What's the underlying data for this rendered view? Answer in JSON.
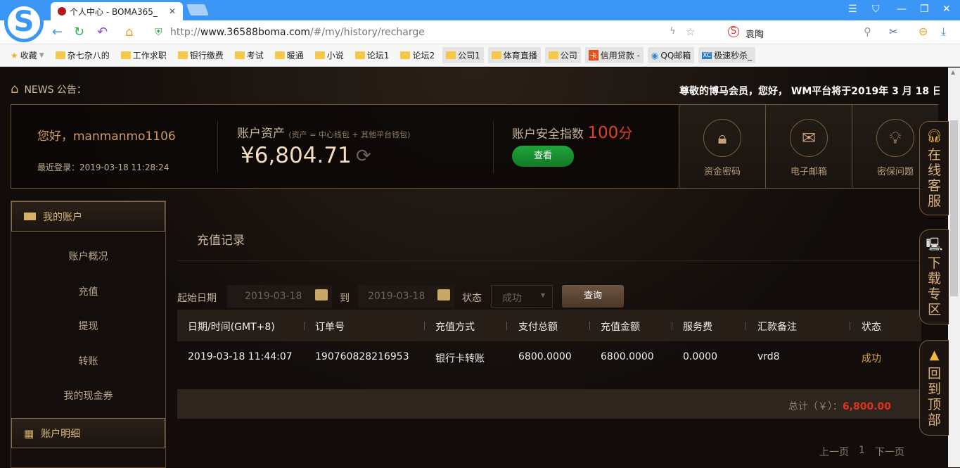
{
  "browser": {
    "tab_title": "个人中心 - BOMA365_",
    "url_prefix": "http://",
    "url_domain": "www.36588boma.com",
    "url_path": "/#/my/history/recharge",
    "search_text": "袁陶",
    "bookmarks": [
      "收藏",
      "杂七杂八的",
      "工作求职",
      "银行缴费",
      "考试",
      "暖通",
      "小说",
      "论坛1",
      "论坛2",
      "公司1",
      "体育直播",
      "公司",
      "信用贷款 -",
      "QQ邮箱",
      "极速秒杀_"
    ]
  },
  "news": {
    "label": "NEWS 公告：",
    "ticker": "尊敬的博马会员，您好， WM平台将于2019年 3 月 18 日"
  },
  "account": {
    "greeting": "您好，manmanmo1106",
    "last_login": "最近登录：2019-03-18 11:28:24",
    "assets_label": "账户资产",
    "assets_note": "(资产 = 中心钱包 + 其他平台钱包)",
    "balance": "¥6,804.71",
    "security_label": "账户安全指数",
    "security_score": "100",
    "security_unit": "分",
    "view_button": "查看",
    "shortcuts": [
      "资金密码",
      "电子邮箱",
      "密保问题"
    ]
  },
  "sidebar": {
    "section1": "我的账户",
    "items": [
      "账户概况",
      "充值",
      "提现",
      "转账",
      "我的现金券"
    ],
    "section2": "账户明细"
  },
  "main": {
    "title": "充值记录",
    "start_label": "起始日期",
    "start_date": "2019-03-18",
    "to_label": "到",
    "end_date": "2019-03-18",
    "status_label": "状态",
    "status_value": "成功",
    "query_button": "查询",
    "columns": [
      "日期/时间(GMT+8)",
      "订单号",
      "充值方式",
      "支付总额",
      "充值金额",
      "服务费",
      "汇款备注",
      "状态"
    ],
    "rows": [
      [
        "2019-03-18 11:44:07",
        "190760828216953",
        "银行卡转账",
        "6800.0000",
        "6800.0000",
        "0.0000",
        "vrd8",
        "成功"
      ]
    ],
    "total_label": "总计（￥）：",
    "total_value": "6,800.00",
    "prev": "上一页",
    "page": "1",
    "next": "下一页"
  },
  "float": [
    "在线客服",
    "下载专区",
    "回到顶部"
  ]
}
